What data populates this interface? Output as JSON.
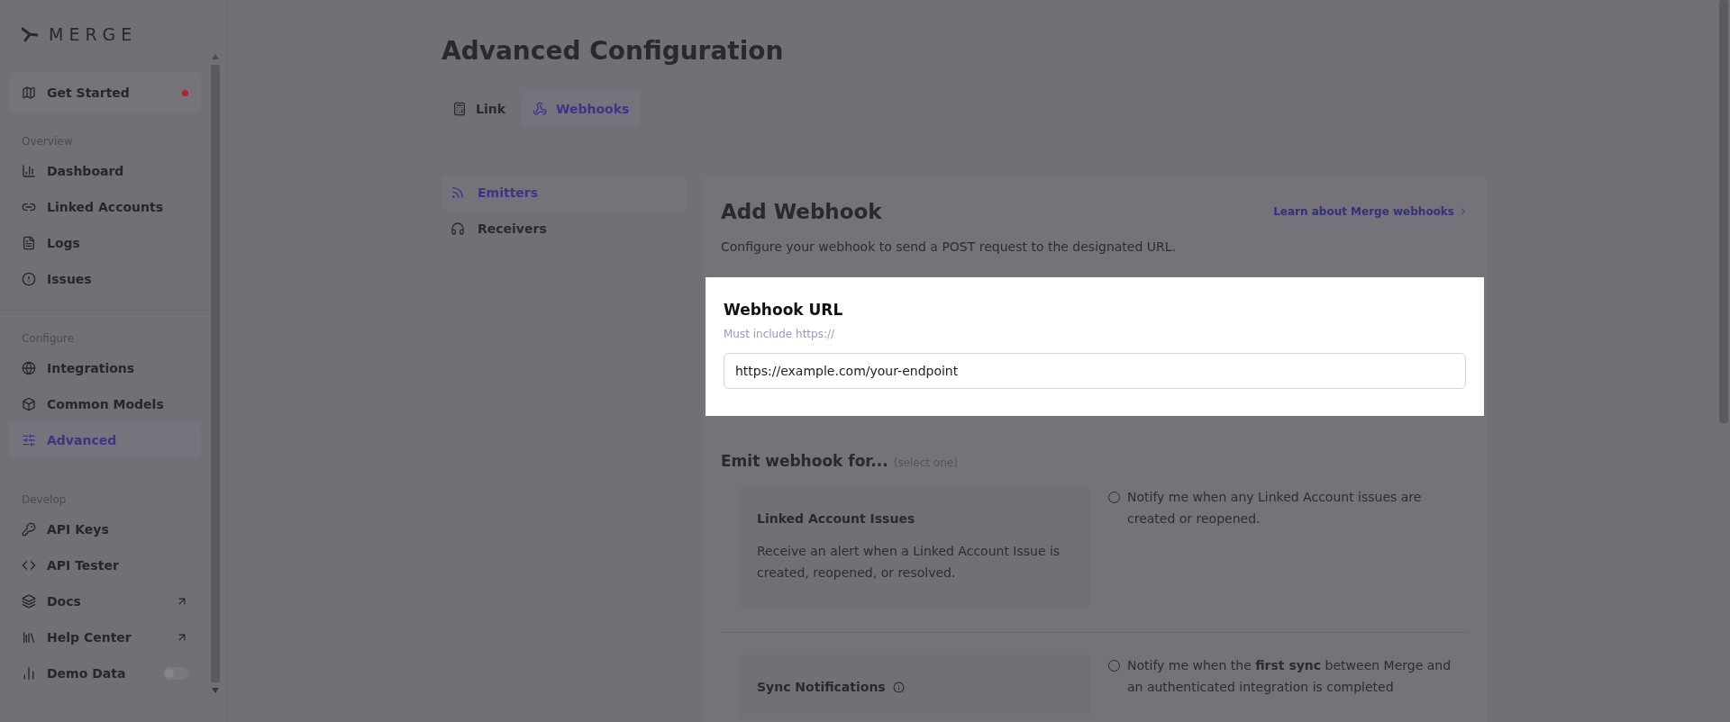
{
  "logo": "MERGE",
  "get_started": {
    "label": "Get Started",
    "notification": true
  },
  "sidebar": [
    {
      "heading": "Overview",
      "items": [
        {
          "label": "Dashboard",
          "kind": "link",
          "selected": false
        },
        {
          "label": "Linked Accounts",
          "kind": "link",
          "selected": false
        },
        {
          "label": "Logs",
          "kind": "link",
          "selected": false
        },
        {
          "label": "Issues",
          "kind": "link",
          "selected": false
        }
      ]
    },
    {
      "heading": "Configure",
      "items": [
        {
          "label": "Integrations",
          "kind": "link",
          "selected": false
        },
        {
          "label": "Common Models",
          "kind": "link",
          "selected": false
        },
        {
          "label": "Advanced",
          "kind": "link",
          "selected": true
        }
      ]
    },
    {
      "heading": "Develop",
      "items": [
        {
          "label": "API Keys",
          "kind": "link",
          "selected": false
        },
        {
          "label": "API Tester",
          "kind": "link",
          "selected": false
        },
        {
          "label": "Docs",
          "kind": "external",
          "selected": false
        },
        {
          "label": "Help Center",
          "kind": "external",
          "selected": false
        },
        {
          "label": "Demo Data",
          "kind": "toggle",
          "selected": false,
          "on": false
        }
      ]
    }
  ],
  "page_title": "Advanced Configuration",
  "tabs": [
    {
      "label": "Link",
      "selected": false
    },
    {
      "label": "Webhooks",
      "selected": true
    }
  ],
  "subnav": [
    {
      "label": "Emitters",
      "selected": true
    },
    {
      "label": "Receivers",
      "selected": false
    }
  ],
  "card": {
    "title": "Add Webhook",
    "link": "Learn about Merge webhooks",
    "description": "Configure your webhook to send a POST request to the designated URL.",
    "url_field": {
      "label": "Webhook URL",
      "hint": "Must include https://",
      "value": "https://example.com/your-endpoint"
    },
    "emit": {
      "title": "Emit webhook for...",
      "note": "(select one)",
      "options": [
        {
          "title": "Linked Account Issues",
          "info": false,
          "description": "Receive an alert when a Linked Account Issue is created, reopened, or resolved.",
          "choice": "Notify me when any Linked Account issues are created or reopened.",
          "selected": false
        },
        {
          "title": "Sync Notifications",
          "info": true,
          "choice": "Notify me when the **first sync** between Merge and an authenticated integration is completed",
          "selected": false
        }
      ]
    }
  }
}
